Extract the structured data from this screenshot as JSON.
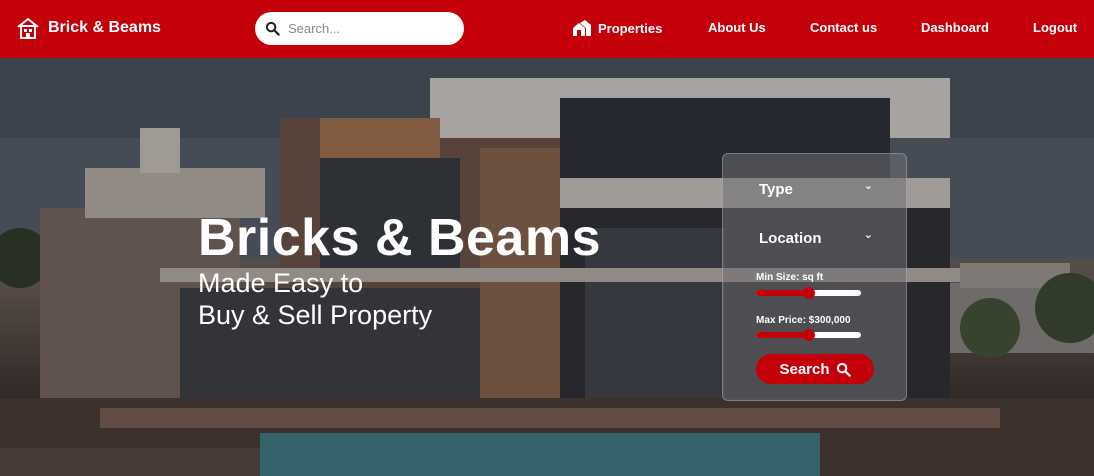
{
  "brand": {
    "name": "Brick & Beams",
    "icon": "house-logo-icon"
  },
  "search": {
    "placeholder": "Search..."
  },
  "nav": {
    "links": [
      {
        "label": "Properties",
        "icon": "houses-icon"
      },
      {
        "label": "About Us"
      },
      {
        "label": "Contact us"
      },
      {
        "label": "Dashboard"
      },
      {
        "label": "Logout"
      }
    ]
  },
  "hero": {
    "title": "Bricks & Beams",
    "subtitle_line1": "Made Easy to",
    "subtitle_line2": "Buy & Sell Property"
  },
  "filters": {
    "type_label": "Type",
    "location_label": "Location",
    "min_size_label": "Min Size: sq ft",
    "min_size_level": 0.5,
    "max_price_label": "Max Price: $300,000",
    "max_price_level": 0.5,
    "search_button": "Search"
  },
  "colors": {
    "brand": "#c4000a",
    "text": "#ffffff"
  }
}
